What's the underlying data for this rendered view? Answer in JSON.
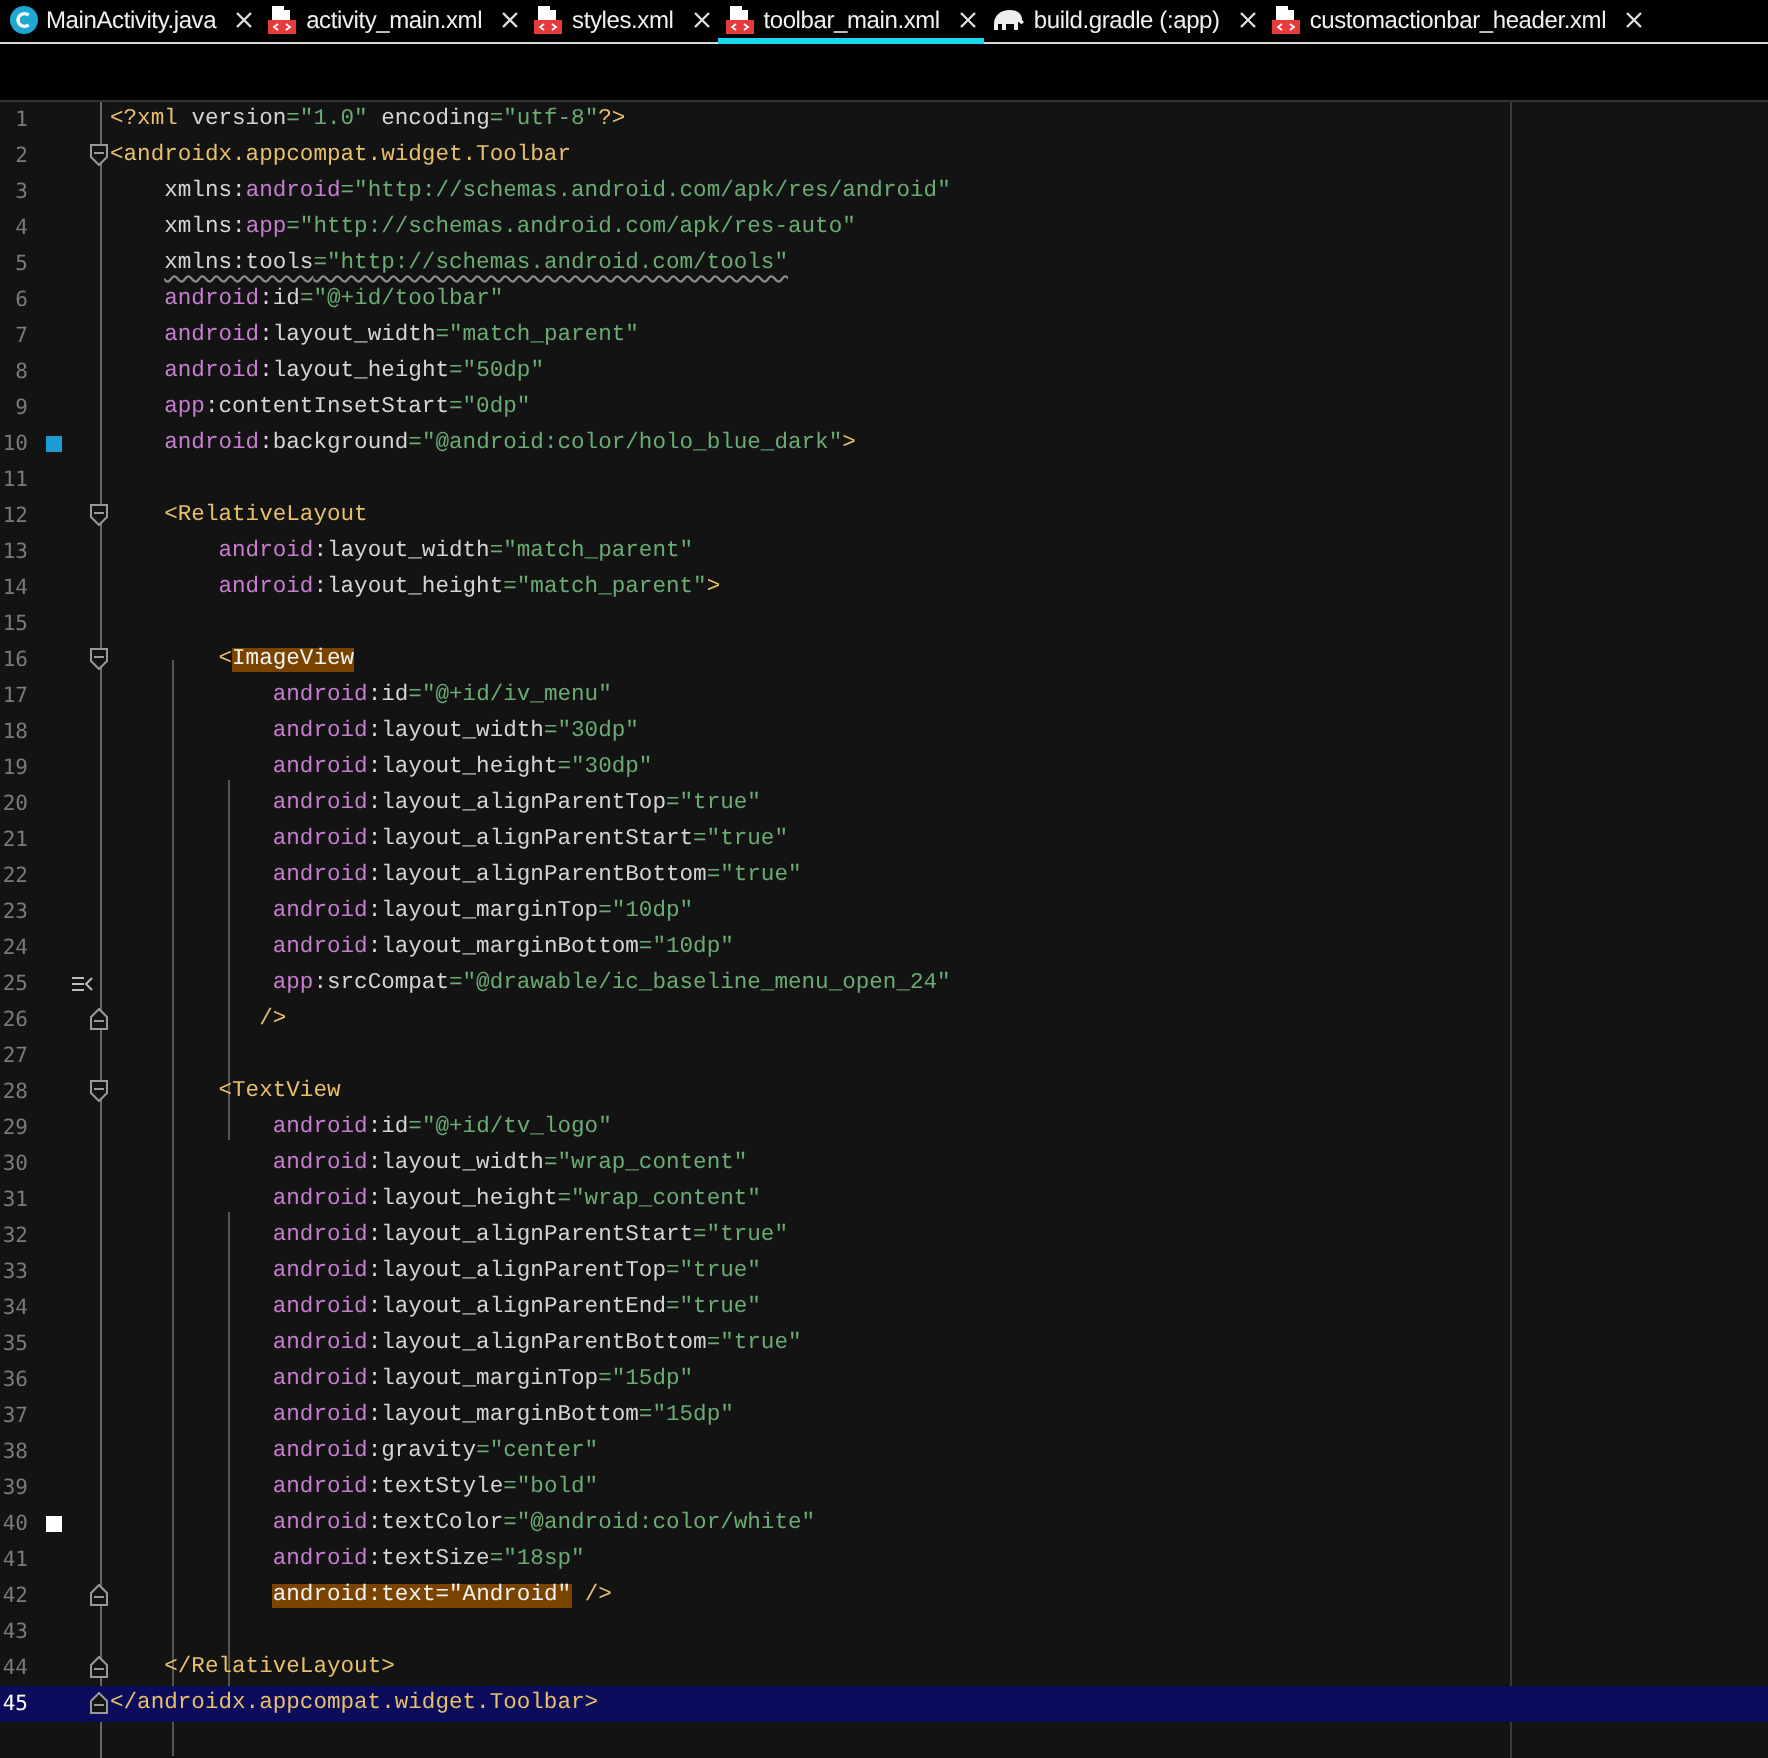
{
  "tabs": [
    {
      "label": "MainActivity.java",
      "kind": "java",
      "selected": false
    },
    {
      "label": "activity_main.xml",
      "kind": "xml",
      "selected": false
    },
    {
      "label": "styles.xml",
      "kind": "xml",
      "selected": false
    },
    {
      "label": "toolbar_main.xml",
      "kind": "xml",
      "selected": true
    },
    {
      "label": "build.gradle (:app)",
      "kind": "gradle",
      "selected": false
    },
    {
      "label": "customactionbar_header.xml",
      "kind": "xml",
      "selected": false
    }
  ],
  "lines": [
    {
      "number": "1",
      "current": false,
      "segments": [
        {
          "text": "<?xml",
          "kind": "tag"
        },
        {
          "text": " version",
          "kind": "attr"
        },
        {
          "text": "=\"1.0\"",
          "kind": "value"
        },
        {
          "text": " encoding",
          "kind": "attr"
        },
        {
          "text": "=\"utf-8\"",
          "kind": "value"
        },
        {
          "text": "?>",
          "kind": "tag"
        }
      ]
    },
    {
      "number": "2",
      "current": false,
      "kind": "open",
      "segments": [
        {
          "text": "<androidx.appcompat.widget.Toolbar",
          "kind": "tag"
        }
      ]
    },
    {
      "number": "3",
      "current": false,
      "segments": [
        {
          "text": "    xmlns:",
          "kind": "attr"
        },
        {
          "text": "android",
          "kind": "ns"
        },
        {
          "text": "=\"http://schemas.android.com/apk/res/android\"",
          "kind": "value"
        }
      ]
    },
    {
      "number": "4",
      "current": false,
      "segments": [
        {
          "text": "    xmlns:",
          "kind": "attr"
        },
        {
          "text": "app",
          "kind": "ns"
        },
        {
          "text": "=\"http://schemas.android.com/apk/res-auto\"",
          "kind": "value"
        }
      ]
    },
    {
      "number": "5",
      "current": false,
      "segments": [
        {
          "text": "    xmlns:tools",
          "kind": "attr",
          "warning": true
        },
        {
          "text": "=\"http://schemas.android.com/tools\"",
          "kind": "value",
          "warning": true
        }
      ]
    },
    {
      "number": "6",
      "current": false,
      "segments": [
        {
          "text": "    android",
          "kind": "ns"
        },
        {
          "text": ":id",
          "kind": "attr"
        },
        {
          "text": "=\"@+id/toolbar\"",
          "kind": "value"
        }
      ]
    },
    {
      "number": "7",
      "current": false,
      "segments": [
        {
          "text": "    android",
          "kind": "ns"
        },
        {
          "text": ":layout_width",
          "kind": "attr"
        },
        {
          "text": "=\"match_parent\"",
          "kind": "value"
        }
      ]
    },
    {
      "number": "8",
      "current": false,
      "segments": [
        {
          "text": "    android",
          "kind": "ns"
        },
        {
          "text": ":layout_height",
          "kind": "attr"
        },
        {
          "text": "=\"50dp\"",
          "kind": "value"
        }
      ]
    },
    {
      "number": "9",
      "current": false,
      "segments": [
        {
          "text": "    app",
          "kind": "ns"
        },
        {
          "text": ":contentInsetStart",
          "kind": "attr"
        },
        {
          "text": "=\"0dp\"",
          "kind": "value"
        }
      ]
    },
    {
      "number": "10",
      "current": false,
      "marker": {
        "kind": "swatch",
        "color": "#1e9bd7"
      },
      "segments": [
        {
          "text": "    android",
          "kind": "ns"
        },
        {
          "text": ":background",
          "kind": "attr"
        },
        {
          "text": "=\"@android:color/holo_blue_dark\"",
          "kind": "value"
        },
        {
          "text": ">",
          "kind": "tag"
        }
      ]
    },
    {
      "number": "11",
      "current": false
    },
    {
      "number": "12",
      "current": false,
      "kind": "open",
      "segments": [
        {
          "text": "    <RelativeLayout",
          "kind": "tag"
        }
      ]
    },
    {
      "number": "13",
      "current": false,
      "segments": [
        {
          "text": "        android",
          "kind": "ns"
        },
        {
          "text": ":layout_width",
          "kind": "attr"
        },
        {
          "text": "=\"match_parent\"",
          "kind": "value"
        }
      ]
    },
    {
      "number": "14",
      "current": false,
      "segments": [
        {
          "text": "        android",
          "kind": "ns"
        },
        {
          "text": ":layout_height",
          "kind": "attr"
        },
        {
          "text": "=\"match_parent\"",
          "kind": "value"
        },
        {
          "text": ">",
          "kind": "tag"
        }
      ]
    },
    {
      "number": "15",
      "current": false
    },
    {
      "number": "16",
      "current": false,
      "kind": "open",
      "segments": [
        {
          "text": "        <",
          "kind": "tag"
        },
        {
          "text": "ImageView",
          "kind": "tag",
          "highlighted": true
        }
      ]
    },
    {
      "number": "17",
      "current": false,
      "segments": [
        {
          "text": "            android",
          "kind": "ns"
        },
        {
          "text": ":id",
          "kind": "attr"
        },
        {
          "text": "=\"@+id/iv_menu\"",
          "kind": "value"
        }
      ]
    },
    {
      "number": "18",
      "current": false,
      "segments": [
        {
          "text": "            android",
          "kind": "ns"
        },
        {
          "text": ":layout_width",
          "kind": "attr"
        },
        {
          "text": "=\"30dp\"",
          "kind": "value"
        }
      ]
    },
    {
      "number": "19",
      "current": false,
      "segments": [
        {
          "text": "            android",
          "kind": "ns"
        },
        {
          "text": ":layout_height",
          "kind": "attr"
        },
        {
          "text": "=\"30dp\"",
          "kind": "value"
        }
      ]
    },
    {
      "number": "20",
      "current": false,
      "segments": [
        {
          "text": "            android",
          "kind": "ns"
        },
        {
          "text": ":layout_alignParentTop",
          "kind": "attr"
        },
        {
          "text": "=\"true\"",
          "kind": "value"
        }
      ]
    },
    {
      "number": "21",
      "current": false,
      "segments": [
        {
          "text": "            android",
          "kind": "ns"
        },
        {
          "text": ":layout_alignParentStart",
          "kind": "attr"
        },
        {
          "text": "=\"true\"",
          "kind": "value"
        }
      ]
    },
    {
      "number": "22",
      "current": false,
      "segments": [
        {
          "text": "            android",
          "kind": "ns"
        },
        {
          "text": ":layout_alignParentBottom",
          "kind": "attr"
        },
        {
          "text": "=\"true\"",
          "kind": "value"
        }
      ]
    },
    {
      "number": "23",
      "current": false,
      "segments": [
        {
          "text": "            android",
          "kind": "ns"
        },
        {
          "text": ":layout_marginTop",
          "kind": "attr"
        },
        {
          "text": "=\"10dp\"",
          "kind": "value"
        }
      ]
    },
    {
      "number": "24",
      "current": false,
      "segments": [
        {
          "text": "            android",
          "kind": "ns"
        },
        {
          "text": ":layout_marginBottom",
          "kind": "attr"
        },
        {
          "text": "=\"10dp\"",
          "kind": "value"
        }
      ]
    },
    {
      "number": "25",
      "current": false,
      "marker": {
        "kind": "image"
      },
      "segments": [
        {
          "text": "            app",
          "kind": "ns"
        },
        {
          "text": ":srcCompat",
          "kind": "attr"
        },
        {
          "text": "=\"@drawable/ic_baseline_menu_open_24\"",
          "kind": "value"
        }
      ]
    },
    {
      "number": "26",
      "current": false,
      "kind": "close",
      "segments": [
        {
          "text": "           />",
          "kind": "tag"
        }
      ]
    },
    {
      "number": "27",
      "current": false
    },
    {
      "number": "28",
      "current": false,
      "kind": "open",
      "segments": [
        {
          "text": "        <TextView",
          "kind": "tag"
        }
      ]
    },
    {
      "number": "29",
      "current": false,
      "segments": [
        {
          "text": "            android",
          "kind": "ns"
        },
        {
          "text": ":id",
          "kind": "attr"
        },
        {
          "text": "=\"@+id/tv_logo\"",
          "kind": "value"
        }
      ]
    },
    {
      "number": "30",
      "current": false,
      "segments": [
        {
          "text": "            android",
          "kind": "ns"
        },
        {
          "text": ":layout_width",
          "kind": "attr"
        },
        {
          "text": "=\"wrap_content\"",
          "kind": "value"
        }
      ]
    },
    {
      "number": "31",
      "current": false,
      "segments": [
        {
          "text": "            android",
          "kind": "ns"
        },
        {
          "text": ":layout_height",
          "kind": "attr"
        },
        {
          "text": "=\"wrap_content\"",
          "kind": "value"
        }
      ]
    },
    {
      "number": "32",
      "current": false,
      "segments": [
        {
          "text": "            android",
          "kind": "ns"
        },
        {
          "text": ":layout_alignParentStart",
          "kind": "attr"
        },
        {
          "text": "=\"true\"",
          "kind": "value"
        }
      ]
    },
    {
      "number": "33",
      "current": false,
      "segments": [
        {
          "text": "            android",
          "kind": "ns"
        },
        {
          "text": ":layout_alignParentTop",
          "kind": "attr"
        },
        {
          "text": "=\"true\"",
          "kind": "value"
        }
      ]
    },
    {
      "number": "34",
      "current": false,
      "segments": [
        {
          "text": "            android",
          "kind": "ns"
        },
        {
          "text": ":layout_alignParentEnd",
          "kind": "attr"
        },
        {
          "text": "=\"true\"",
          "kind": "value"
        }
      ]
    },
    {
      "number": "35",
      "current": false,
      "segments": [
        {
          "text": "            android",
          "kind": "ns"
        },
        {
          "text": ":layout_alignParentBottom",
          "kind": "attr"
        },
        {
          "text": "=\"true\"",
          "kind": "value"
        }
      ]
    },
    {
      "number": "36",
      "current": false,
      "segments": [
        {
          "text": "            android",
          "kind": "ns"
        },
        {
          "text": ":layout_marginTop",
          "kind": "attr"
        },
        {
          "text": "=\"15dp\"",
          "kind": "value"
        }
      ]
    },
    {
      "number": "37",
      "current": false,
      "segments": [
        {
          "text": "            android",
          "kind": "ns"
        },
        {
          "text": ":layout_marginBottom",
          "kind": "attr"
        },
        {
          "text": "=\"15dp\"",
          "kind": "value"
        }
      ]
    },
    {
      "number": "38",
      "current": false,
      "segments": [
        {
          "text": "            android",
          "kind": "ns"
        },
        {
          "text": ":gravity",
          "kind": "attr"
        },
        {
          "text": "=\"center\"",
          "kind": "value"
        }
      ]
    },
    {
      "number": "39",
      "current": false,
      "segments": [
        {
          "text": "            android",
          "kind": "ns"
        },
        {
          "text": ":textStyle",
          "kind": "attr"
        },
        {
          "text": "=\"bold\"",
          "kind": "value"
        }
      ]
    },
    {
      "number": "40",
      "current": false,
      "marker": {
        "kind": "swatch",
        "color": "#ffffff"
      },
      "segments": [
        {
          "text": "            android",
          "kind": "ns"
        },
        {
          "text": ":textColor",
          "kind": "attr"
        },
        {
          "text": "=\"@android:color/white\"",
          "kind": "value"
        }
      ]
    },
    {
      "number": "41",
      "current": false,
      "segments": [
        {
          "text": "            android",
          "kind": "ns"
        },
        {
          "text": ":textSize",
          "kind": "attr"
        },
        {
          "text": "=\"18sp\"",
          "kind": "value"
        }
      ]
    },
    {
      "number": "42",
      "current": false,
      "kind": "close",
      "segments": [
        {
          "text": "            android",
          "kind": "ns",
          "highlighted": true
        },
        {
          "text": ":text",
          "kind": "attr",
          "highlighted": true
        },
        {
          "text": "=\"Android\"",
          "kind": "value",
          "highlighted": true
        },
        {
          "text": " />",
          "kind": "tag"
        }
      ]
    },
    {
      "number": "43",
      "current": false
    },
    {
      "number": "44",
      "current": false,
      "kind": "close",
      "segments": [
        {
          "text": "    </RelativeLayout>",
          "kind": "tag"
        }
      ]
    },
    {
      "number": "45",
      "current": true,
      "kind": "close",
      "segments": [
        {
          "text": "</androidx.appcompat.widget.Toolbar>",
          "kind": "tag"
        }
      ]
    }
  ]
}
